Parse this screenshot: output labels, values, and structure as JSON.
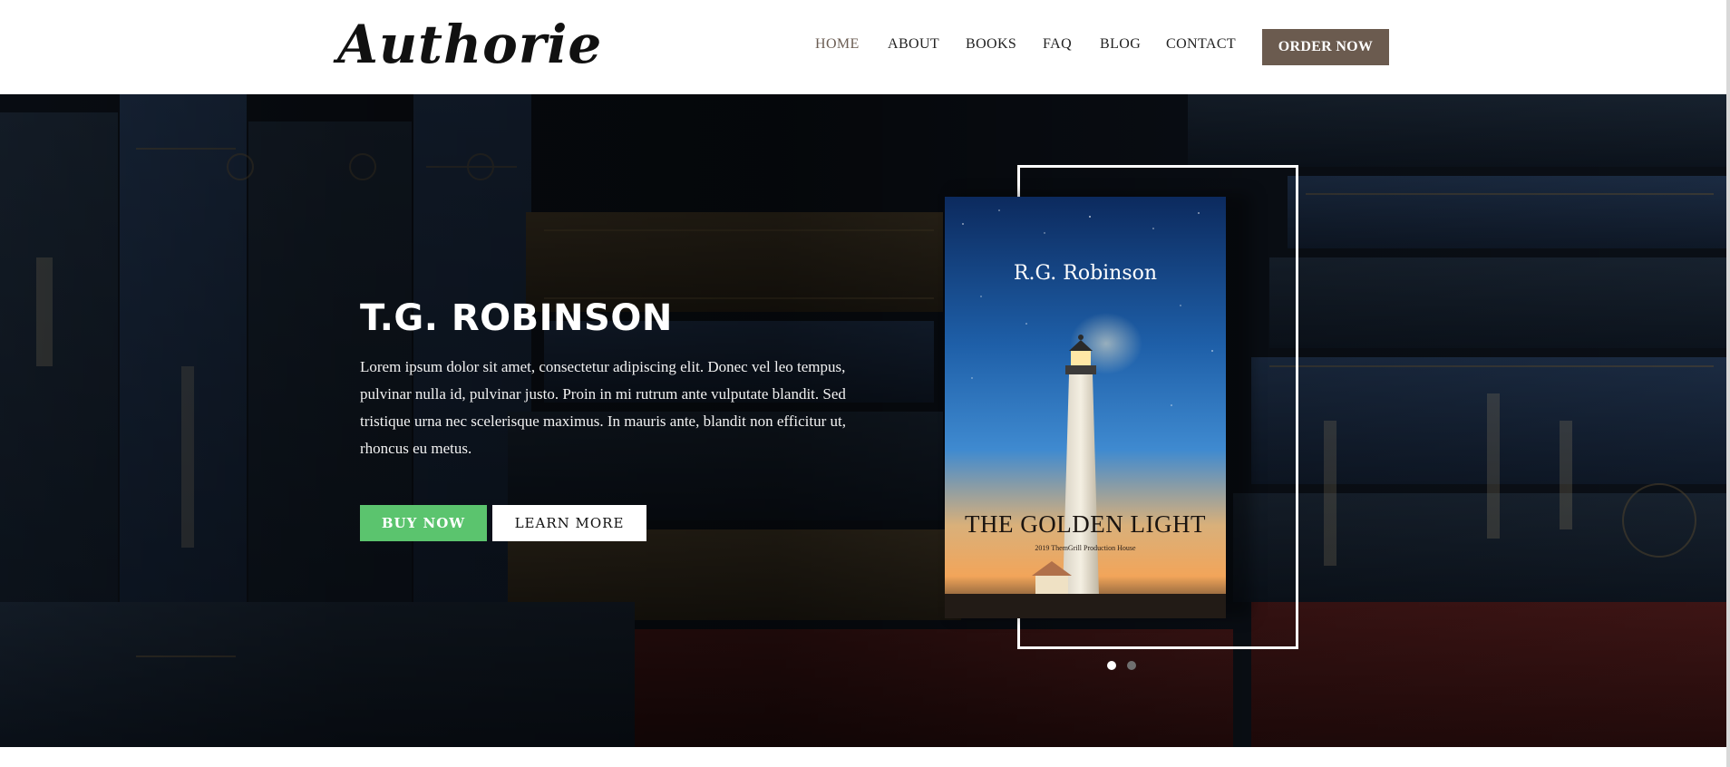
{
  "header": {
    "logo": "Authorie",
    "nav": [
      {
        "label": "HOME",
        "active": true
      },
      {
        "label": "ABOUT",
        "active": false
      },
      {
        "label": "BOOKS",
        "active": false
      },
      {
        "label": "FAQ",
        "active": false
      },
      {
        "label": "BLOG",
        "active": false
      },
      {
        "label": "CONTACT",
        "active": false
      }
    ],
    "cta_label": "ORDER NOW"
  },
  "hero": {
    "title": "T.G. ROBINSON",
    "description": "Lorem ipsum dolor sit amet, consectetur adipiscing elit. Donec vel leo tempus, pulvinar nulla id, pulvinar justo. Proin in mi rutrum ante vulputate blandit. Sed tristique urna nec scelerisque maximus. In mauris ante, blandit non efficitur ut, rhoncus eu metus.",
    "buy_label": "BUY NOW",
    "learn_label": "LEARN MORE"
  },
  "book": {
    "author": "R.G. Robinson",
    "title": "THE GOLDEN LIGHT",
    "subtitle": "2019 ThemGrill Production House"
  },
  "carousel": {
    "slides": 2,
    "active": 1
  },
  "colors": {
    "accent": "#6b5b4f",
    "buy": "#5bc46e",
    "nav_active": "#6b5d53"
  }
}
